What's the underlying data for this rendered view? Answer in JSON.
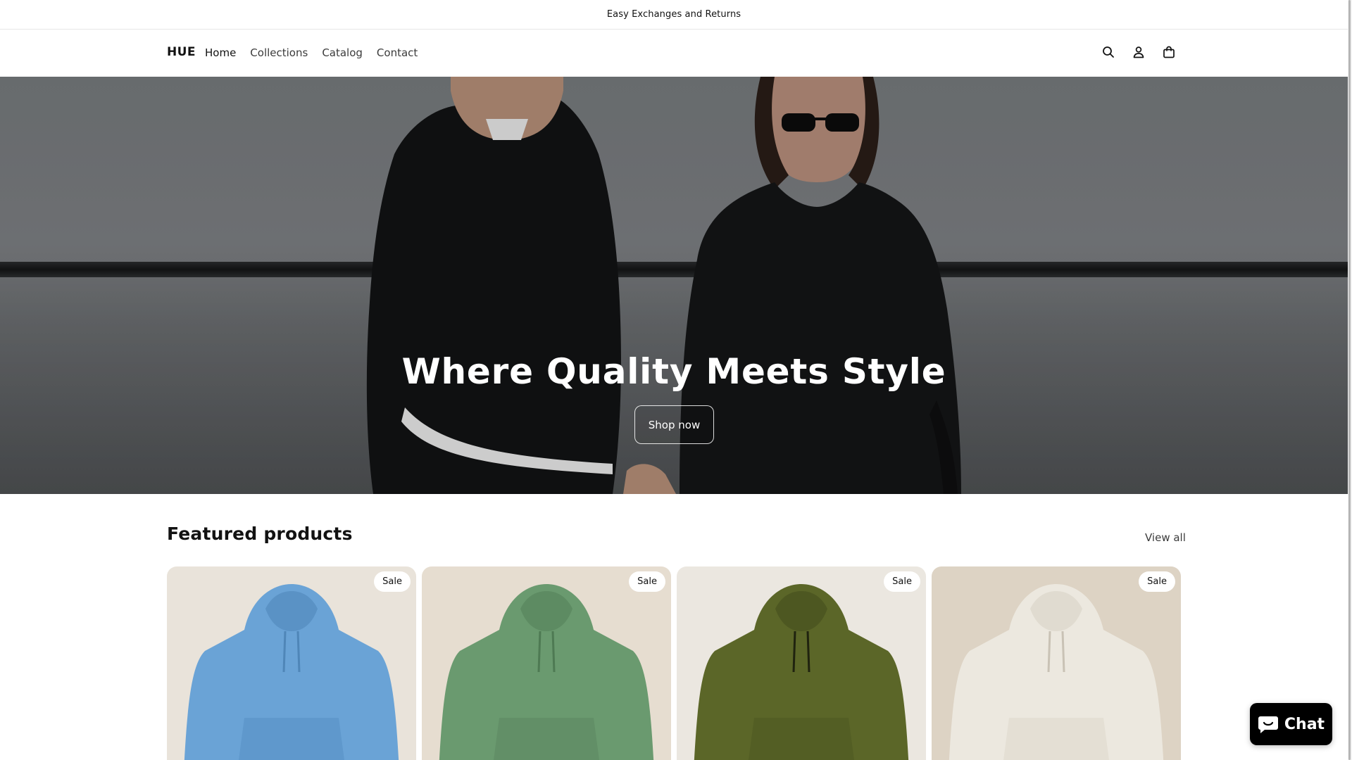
{
  "announcement": {
    "text": "Easy Exchanges and Returns"
  },
  "header": {
    "logo": "HUE",
    "nav": [
      "Home",
      "Collections",
      "Catalog",
      "Contact"
    ],
    "icons": [
      "search-icon",
      "account-icon",
      "cart-icon"
    ]
  },
  "hero": {
    "title": "Where Quality Meets Style",
    "button": "Shop now"
  },
  "featured": {
    "title": "Featured products",
    "view_all": "View all",
    "products": [
      {
        "badge": "Sale",
        "color": "#6aa3d6",
        "bg": "#e9e3da"
      },
      {
        "badge": "Sale",
        "color": "#6a9a6f",
        "bg": "#e6ddd0"
      },
      {
        "badge": "Sale",
        "color": "#5b6628",
        "bg": "#ebe7e0"
      },
      {
        "badge": "Sale",
        "color": "#ece8df",
        "bg": "#ddd3c4"
      }
    ]
  },
  "chat": {
    "label": "Chat"
  }
}
